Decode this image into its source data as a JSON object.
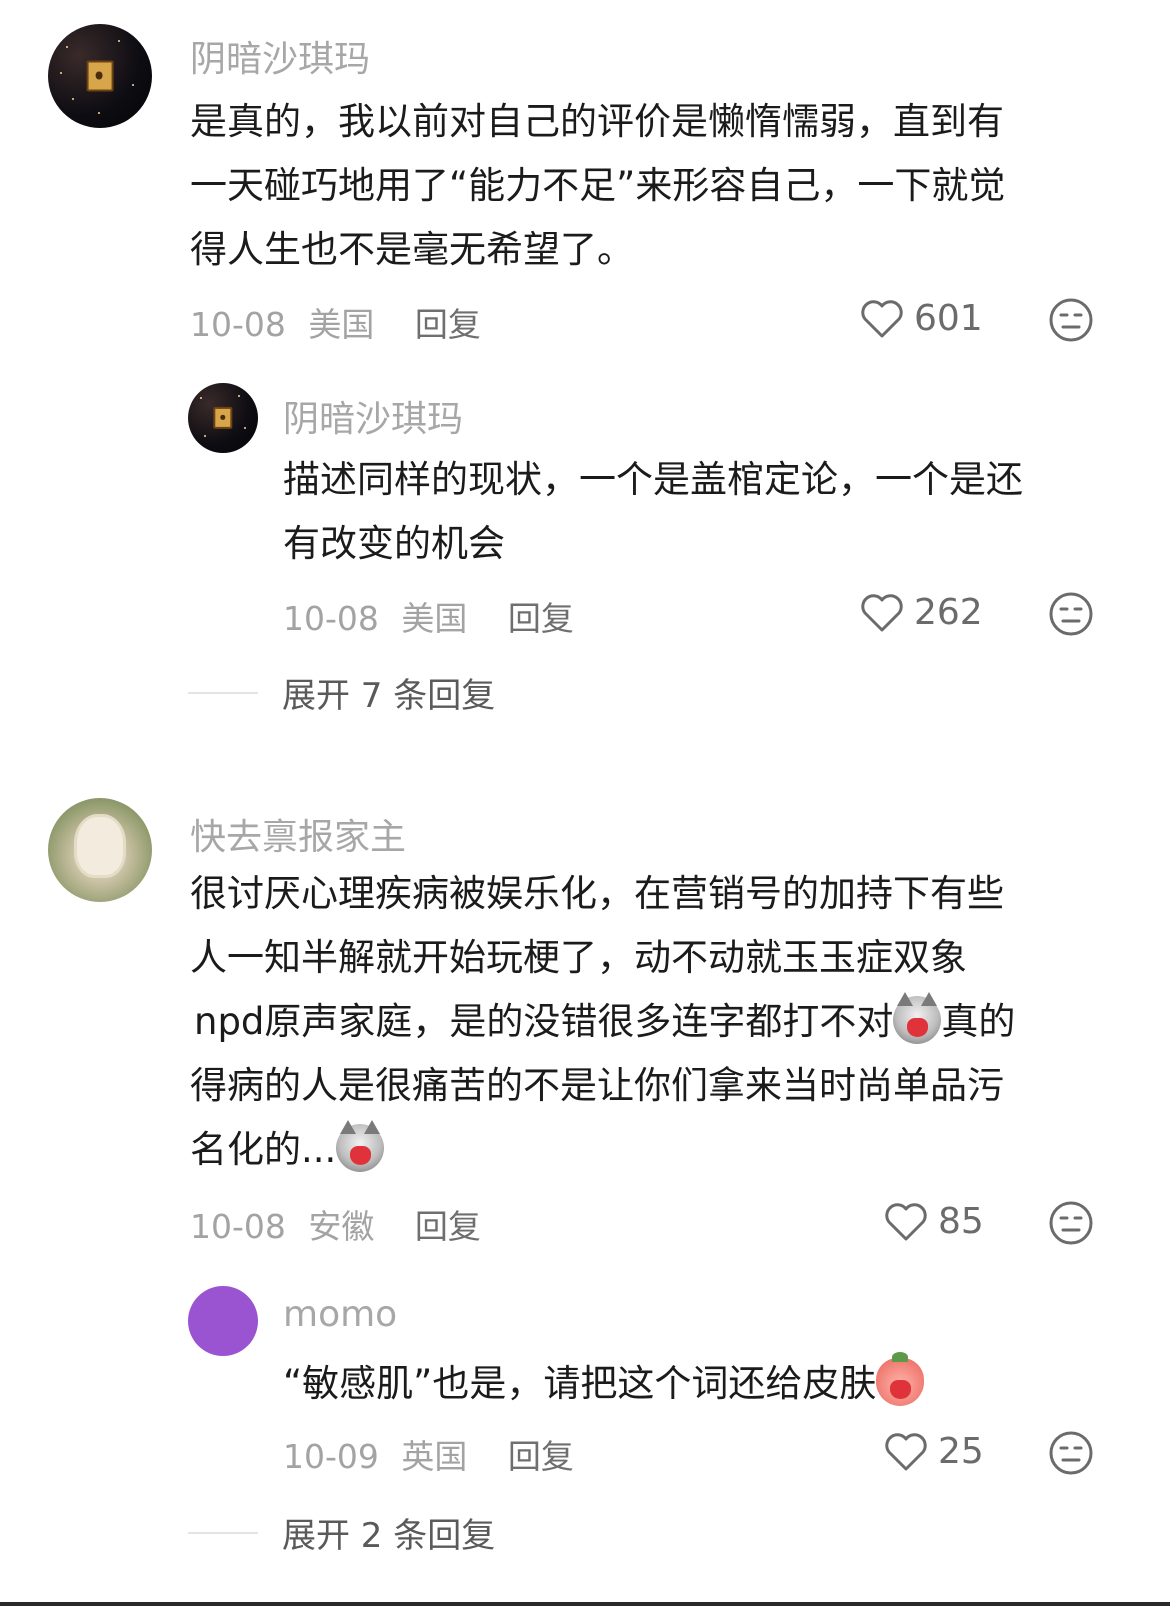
{
  "comments": [
    {
      "username": "阴暗沙琪玛",
      "text": "是真的，我以前对自己的评价是懒惰懦弱，直到有\n一天碰巧地用了“能力不足”来形容自己，一下就觉\n得人生也不是毫无希望了。",
      "date": "10-08",
      "location": "美国",
      "reply_label": "回复",
      "likes": "601",
      "replies": [
        {
          "username": "阴暗沙琪玛",
          "text": "描述同样的现状，一个是盖棺定论，一个是还\n有改变的机会",
          "date": "10-08",
          "location": "美国",
          "reply_label": "回复",
          "likes": "262"
        }
      ],
      "expand_label": "展开 7 条回复"
    },
    {
      "username": "快去禀报家主",
      "text_lines": [
        "很讨厌心理疾病被娱乐化，在营销号的加持下有些",
        "人一知半解就开始玩梗了，动不动就玉玉症双象",
        "npd原声家庭，是的没错很多连字都打不对",
        "真的",
        "得病的人是很痛苦的不是让你们拿来当时尚单品污",
        "名化的..."
      ],
      "date": "10-08",
      "location": "安徽",
      "reply_label": "回复",
      "likes": "85",
      "replies": [
        {
          "username": "momo",
          "text": "“敏感肌”也是，请把这个词还给皮肤",
          "date": "10-09",
          "location": "英国",
          "reply_label": "回复",
          "likes": "25"
        }
      ],
      "expand_label": "展开 2 条回复"
    }
  ],
  "icons": {
    "like": "heart-outline-icon",
    "dislike": "neutral-face-icon",
    "emoji_cat": "crying-cat-emoji",
    "emoji_peach": "crying-peach-emoji"
  },
  "colors": {
    "username": "#a7a7a7",
    "text": "#1b1b1b",
    "meta": "#a3a3a3",
    "avatar_momo": "#9a54d2"
  }
}
